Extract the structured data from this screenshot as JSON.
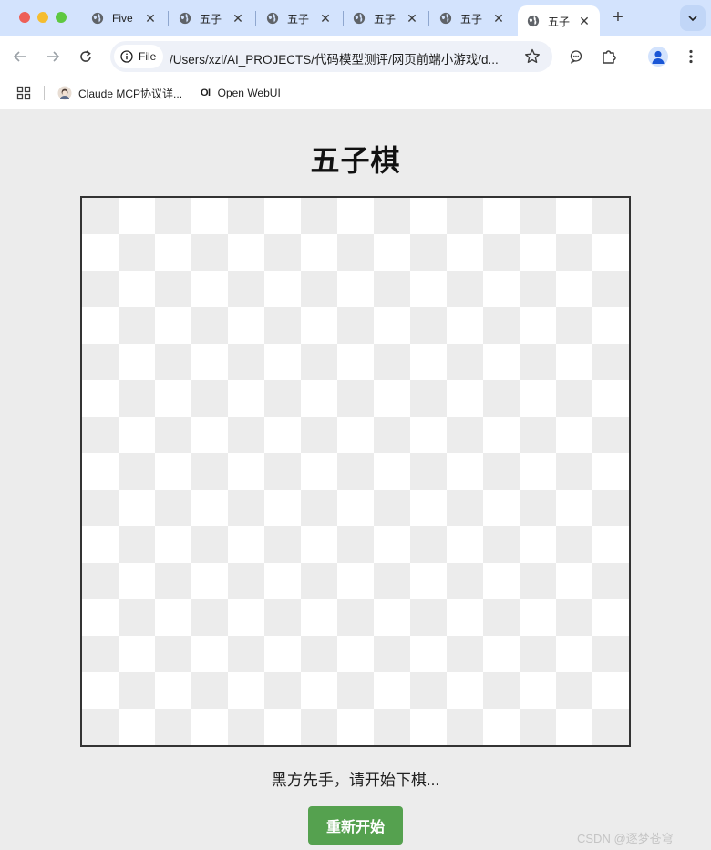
{
  "browser": {
    "tabs": [
      {
        "title": "Five",
        "active": false
      },
      {
        "title": "五子",
        "active": false
      },
      {
        "title": "五子",
        "active": false
      },
      {
        "title": "五子",
        "active": false
      },
      {
        "title": "五子",
        "active": false
      },
      {
        "title": "五子",
        "active": true
      }
    ],
    "scheme_chip": "File",
    "url": "/Users/xzl/AI_PROJECTS/代码模型测评/网页前端小游戏/d...",
    "bookmarks": [
      {
        "label": "Claude MCP协议详..."
      },
      {
        "label": "Open WebUI"
      }
    ],
    "bookmark_icon_text": "OI"
  },
  "game": {
    "title": "五子棋",
    "board": {
      "checker_colors": [
        "#ececec",
        "#ffffff"
      ],
      "checker_columns": 15,
      "checker_rows": 15,
      "border_color": "#333333"
    },
    "status": "黑方先手，请开始下棋...",
    "restart_label": "重新开始",
    "accent_color": "#55a14f"
  },
  "watermark": "CSDN @逐梦苍穹"
}
